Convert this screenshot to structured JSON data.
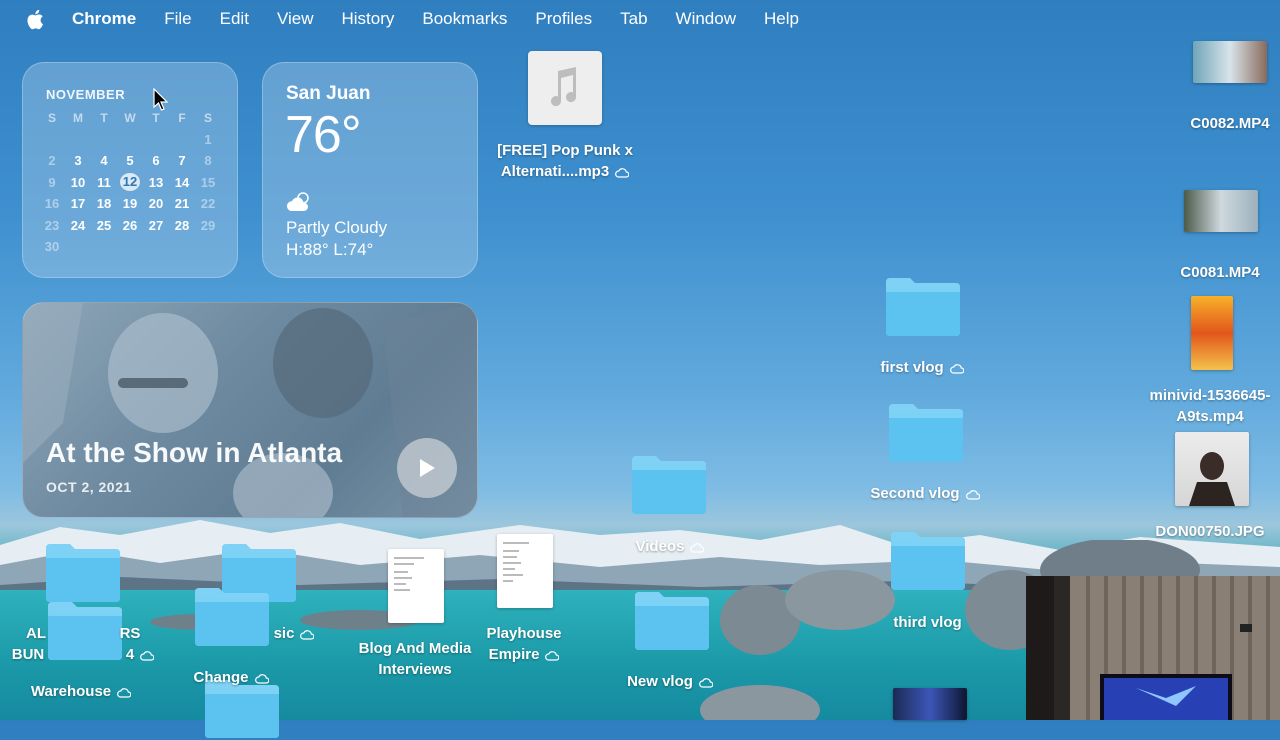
{
  "menubar": {
    "app": "Chrome",
    "items": [
      "File",
      "Edit",
      "View",
      "History",
      "Bookmarks",
      "Profiles",
      "Tab",
      "Window",
      "Help"
    ]
  },
  "calendar": {
    "month": "NOVEMBER",
    "weekdays": [
      "S",
      "M",
      "T",
      "W",
      "T",
      "F",
      "S"
    ],
    "today": 12,
    "rows": [
      [
        "",
        "",
        "",
        "",
        "",
        "",
        "1"
      ],
      [
        "2",
        "3",
        "4",
        "5",
        "6",
        "7",
        "8"
      ],
      [
        "9",
        "10",
        "11",
        "12",
        "13",
        "14",
        "15"
      ],
      [
        "16",
        "17",
        "18",
        "19",
        "20",
        "21",
        "22"
      ],
      [
        "23",
        "24",
        "25",
        "26",
        "27",
        "28",
        "29"
      ],
      [
        "30",
        "",
        "",
        "",
        "",
        "",
        ""
      ]
    ]
  },
  "weather": {
    "city": "San Juan",
    "temp": "76°",
    "condition": "Partly Cloudy",
    "high_low": "H:88° L:74°"
  },
  "photo_widget": {
    "title": "At the Show in Atlanta",
    "date": "OCT 2, 2021"
  },
  "desktop": {
    "mp3_line1": "[FREE] Pop Punk x",
    "mp3_line2": "Alternati....mp3",
    "c0082": "C0082.MP4",
    "c0081": "C0081.MP4",
    "minivid_line1": "minivid-1536645-",
    "minivid_line2": "A9ts.mp4",
    "don": "DON00750.JPG",
    "first_vlog": "first vlog",
    "second_vlog": "Second vlog",
    "third_vlog": "third vlog",
    "videos": "Videos",
    "new_vlog": "New vlog",
    "playhouse_line1": "Playhouse",
    "playhouse_line2": "Empire",
    "blog_line1": "Blog And Media",
    "blog_line2": "Interviews",
    "al_line1": "AL",
    "rs_line1": "RS",
    "bun_line2": "BUN",
    "four_line2": "4",
    "warehouse": "Warehouse",
    "sic": "sic",
    "change": "Change"
  },
  "colors": {
    "folder": "#5cc3f0",
    "folder_tab": "#7fd2f5",
    "today_bg": "#dbe9f4"
  }
}
